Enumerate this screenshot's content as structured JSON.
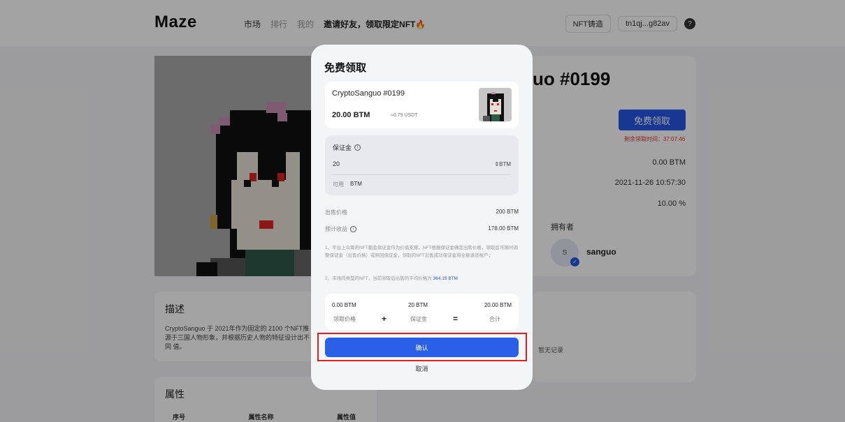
{
  "header": {
    "logo": "Maze",
    "nav": [
      "市场",
      "排行",
      "我的"
    ],
    "invite": "邀请好友，领取限定NFT🔥",
    "mint_button": "NFT铸造",
    "wallet": "tn1qj...g82av",
    "help_icon": "help-icon"
  },
  "detail": {
    "title_partial": "uo #0199",
    "claim_button": "免费领取",
    "remaining_time": "剩余领取时间：37:07:46",
    "values": [
      "0.00 BTM",
      "2021-11-26 10:57:30",
      "10.00 %"
    ],
    "owner_label": "拥有者",
    "owner_avatar": "S",
    "owner_name": "sanguo"
  },
  "description": {
    "title": "描述",
    "text": "CryptoSanguo 于 2021年作为固定的 2100 个NFT推 源于三国人物形象，并根据历史人物的特征设计出不同 值。"
  },
  "records": {
    "empty": "暂无记录"
  },
  "attributes": {
    "title": "属性",
    "headers": [
      "序号",
      "属性名称",
      "属性值"
    ]
  },
  "modal": {
    "title": "免费领取",
    "item": {
      "name": "CryptoSanguo #0199",
      "price": "20.00 BTM",
      "usdt": "≈0.79 USDT"
    },
    "deposit": {
      "label": "保证金",
      "value": "20",
      "unit": "BTM",
      "available_label": "可用",
      "available_value": "BTM"
    },
    "sell_price_label": "出售价格",
    "sell_price_value": "200 BTM",
    "expected_label": "预计收益",
    "expected_value": "178.00 BTM",
    "note1": "1、平台上众筹的NFT都会保证金作为价值支撑，NFT根据保证金确定出售价格，领取后可随时调整保证金（出售价格）或赎回保证金，领取的NFT出售成功保证金将全额退还账户；",
    "note2_prefix": "2、市场同类型的NFT，当前领取后出售的平均价格为",
    "note2_link": "364.15 BTM",
    "summary": {
      "claim_value": "0.00 BTM",
      "claim_label": "领取价格",
      "deposit_value": "20 BTM",
      "deposit_label": "保证金",
      "total_value": "20.00 BTM",
      "total_label": "合计",
      "plus": "+",
      "equals": "="
    },
    "confirm": "确认",
    "cancel": "取消"
  }
}
